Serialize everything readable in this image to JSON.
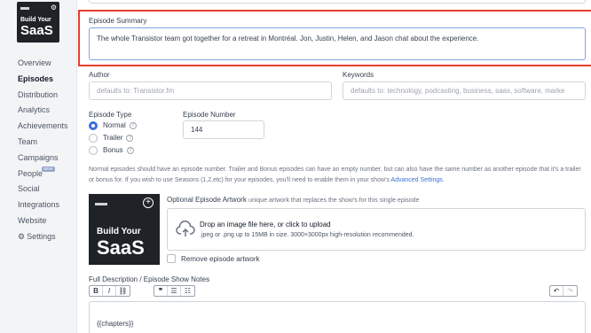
{
  "sidebar": {
    "cover": {
      "line1": "Build Your",
      "line2": "SaaS"
    },
    "items": [
      {
        "label": "Overview"
      },
      {
        "label": "Episodes"
      },
      {
        "label": "Distribution"
      },
      {
        "label": "Analytics"
      },
      {
        "label": "Achievements"
      },
      {
        "label": "Team"
      },
      {
        "label": "Campaigns"
      },
      {
        "label": "People",
        "badge": "NEW"
      },
      {
        "label": "Social"
      },
      {
        "label": "Integrations"
      },
      {
        "label": "Website"
      },
      {
        "label": "Settings"
      }
    ],
    "active": "Episodes"
  },
  "form": {
    "summary": {
      "label": "Episode Summary",
      "value": "The whole Transistor team got together for a retreat in Montréal. Jon, Justin, Helen, and Jason chat about the experience."
    },
    "author": {
      "label": "Author",
      "placeholder": "defaults to: Transistor.fm"
    },
    "keywords": {
      "label": "Keywords",
      "placeholder": "defaults to: technology, podcasting, business, saas, software, marke"
    },
    "episode_type": {
      "label": "Episode Type",
      "options": [
        "Normal",
        "Trailer",
        "Bonus"
      ],
      "selected": "Normal"
    },
    "episode_number": {
      "label": "Episode Number",
      "value": "144"
    },
    "hint": {
      "text": "Normal episodes should have an episode number. Trailer and Bonus episodes can have an empty number, but can also have the same number as another episode that it's a trailer or bonus for. If you wish to use Seasons (1,2,etc) for your episodes, you'll need to enable them in your show's ",
      "link": "Advanced Settings",
      "end": "."
    },
    "artwork": {
      "label": "Optional Episode Artwork",
      "sublabel": "unique artwork that replaces the show's for this single episode",
      "cover_line1": "Build Your",
      "cover_line2": "SaaS",
      "drop_title": "Drop an image file here, or click to upload",
      "drop_sub": ".jpeg or .png up to 15MB in size. 3000×3000px high-resolution recommended.",
      "remove_label": "Remove episode artwork"
    },
    "description": {
      "label": "Full Description / Episode Show Notes",
      "content": "{{chapters}}"
    }
  },
  "colors": {
    "accent": "#3b6fd8",
    "highlight": "#e53e2f",
    "sidebar": "#f3f4f6"
  }
}
